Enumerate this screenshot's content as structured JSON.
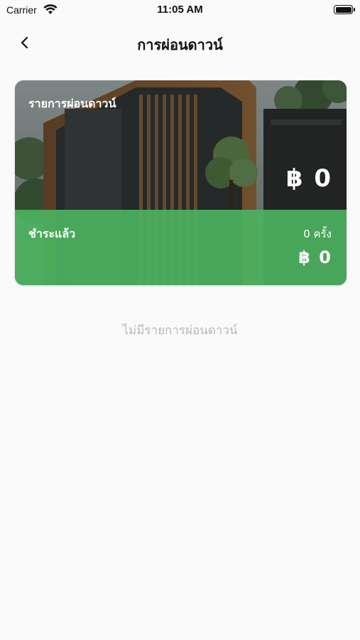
{
  "status_bar": {
    "carrier": "Carrier",
    "time": "11:05 AM"
  },
  "nav": {
    "title": "การผ่อนดาวน์",
    "back_icon": "chevron-left-icon"
  },
  "card": {
    "title": "รายการผ่อนดาวน์",
    "total_amount": "฿ 0",
    "paid": {
      "label": "ชำระแล้ว",
      "count": "0 ครั้ง",
      "amount": "฿ 0"
    }
  },
  "empty_state": {
    "message": "ไม่มีรายการผ่อนดาวน์"
  },
  "colors": {
    "paid_green": "#4cb260",
    "empty_text": "#b9b9b9",
    "background": "#fafafa"
  }
}
